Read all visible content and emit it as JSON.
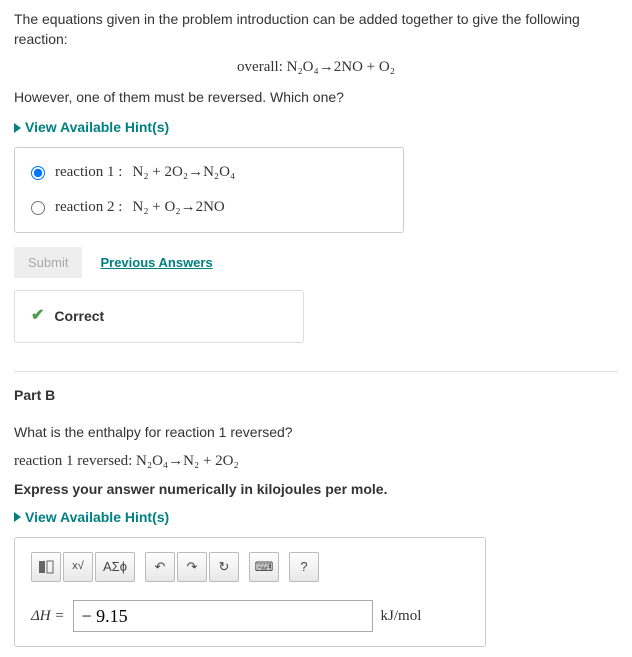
{
  "intro": "The equations given in the problem introduction can be added together to give the following reaction:",
  "overall_label": "overall:",
  "overall_eq": "N₂O₄→2NO + O₂",
  "followup": "However, one of them must be reversed. Which one?",
  "hints_label": "View Available Hint(s)",
  "choices": [
    {
      "label": "reaction 1 :",
      "eq": "N₂ + 2O₂→N₂O₄",
      "selected": true
    },
    {
      "label": "reaction 2 :",
      "eq": "N₂ + O₂→2NO",
      "selected": false
    }
  ],
  "submit_label": "Submit",
  "prev_label": "Previous Answers",
  "correct_label": "Correct",
  "part_b": {
    "title": "Part B",
    "question": "What is the enthalpy for reaction 1 reversed?",
    "rxn_label": "reaction 1 reversed:",
    "rxn_eq": "N₂O₄→N₂ + 2O₂",
    "express": "Express your answer numerically in kilojoules per mole.",
    "dh_label": "ΔH =",
    "value": "− 9.15",
    "unit": "kJ/mol",
    "toolbar": {
      "format": "format",
      "sqrt": "√",
      "greek": "ΑΣϕ",
      "undo": "↶",
      "redo": "↷",
      "reset": "↻",
      "keyboard": "⌨",
      "help": "?"
    }
  }
}
